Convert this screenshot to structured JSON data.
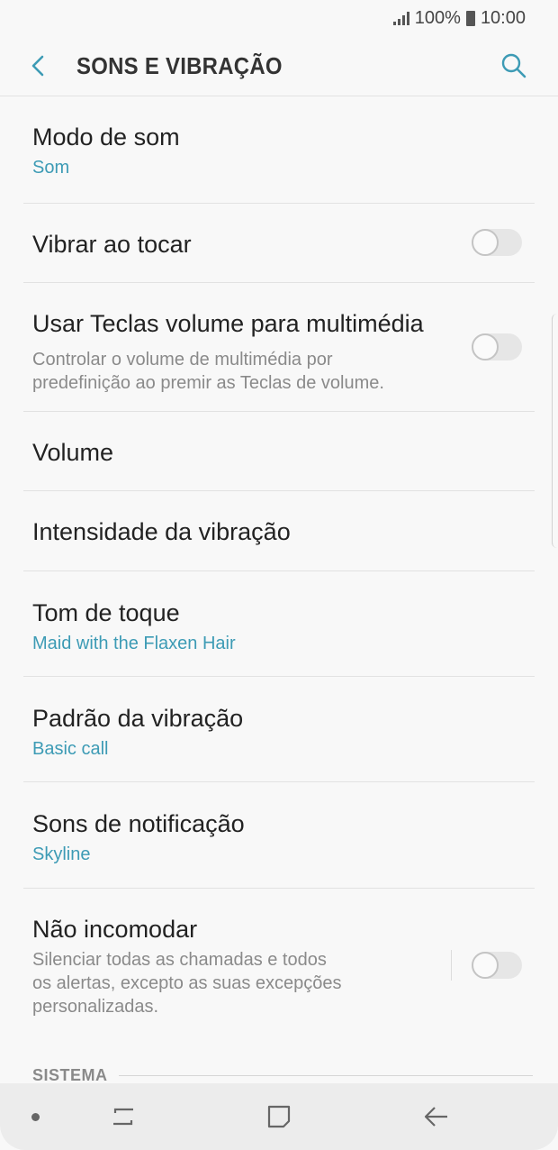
{
  "status_bar": {
    "battery": "100%",
    "time": "10:00"
  },
  "header": {
    "title": "SONS E VIBRAÇÃO",
    "back_icon": "back-arrow-icon",
    "search_icon": "search-icon"
  },
  "settings": [
    {
      "label": "Modo de som",
      "value": "Som"
    },
    {
      "label": "Vibrar ao tocar",
      "toggle": false
    },
    {
      "label": "Usar Teclas volume para multimédia",
      "description": [
        "Controlar o volume de multimédia por",
        "predefinição ao premir as Teclas de volume."
      ],
      "toggle": false
    },
    {
      "label": "Volume"
    },
    {
      "label": "Intensidade da vibração"
    },
    {
      "label": "Tom de toque",
      "value": "Maid with the Flaxen Hair"
    },
    {
      "label": "Padrão da vibração",
      "value": "Basic call"
    },
    {
      "label": "Sons de notificação",
      "value": "Skyline"
    },
    {
      "label": "Não incomodar",
      "description": [
        "Silenciar todas as chamadas e todos",
        "os alertas, excepto as suas excepções",
        "personalizadas."
      ],
      "toggle": false
    }
  ],
  "section": {
    "label": "SISTEMA"
  },
  "nav_bar": {
    "buttons": [
      "recents-icon",
      "home-icon",
      "back-icon"
    ]
  },
  "colors": {
    "accent": "#3d9bb5",
    "background": "#f8f8f8"
  }
}
